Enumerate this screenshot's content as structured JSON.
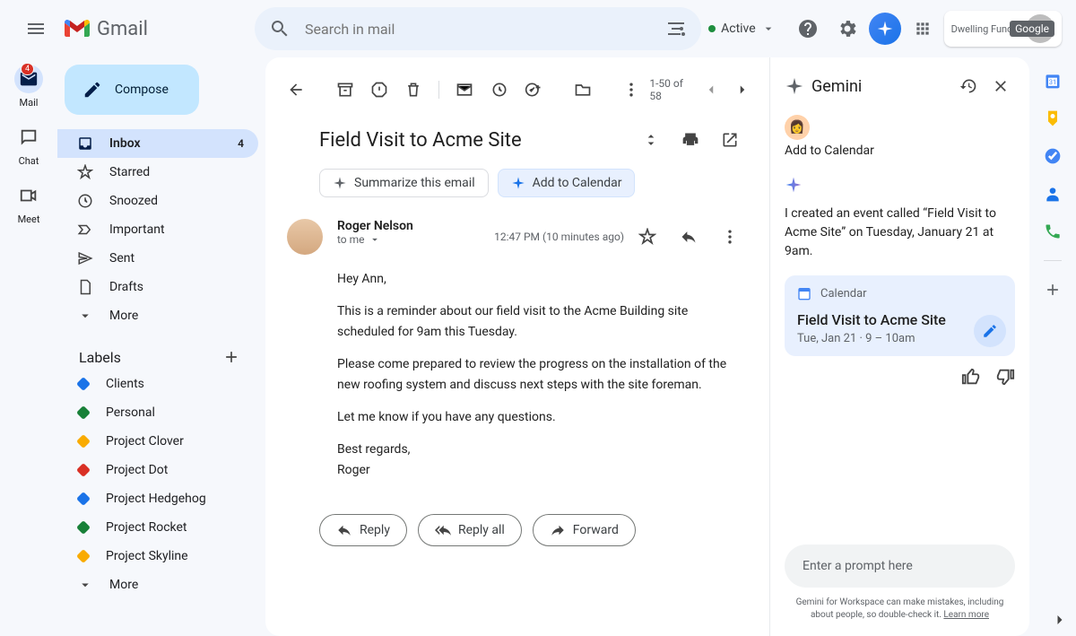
{
  "header": {
    "product": "Gmail",
    "search_placeholder": "Search in mail",
    "status": "Active",
    "profile_org": "Dwelling Fund...",
    "google_badge": "Google"
  },
  "rail": {
    "mail": "Mail",
    "mail_badge": "4",
    "chat": "Chat",
    "meet": "Meet"
  },
  "sidebar": {
    "compose": "Compose",
    "items": [
      {
        "label": "Inbox",
        "count": "4"
      },
      {
        "label": "Starred"
      },
      {
        "label": "Snoozed"
      },
      {
        "label": "Important"
      },
      {
        "label": "Sent"
      },
      {
        "label": "Drafts"
      },
      {
        "label": "More"
      }
    ],
    "labels_header": "Labels",
    "labels": [
      {
        "label": "Clients",
        "color": "#1a73e8"
      },
      {
        "label": "Personal",
        "color": "#188038"
      },
      {
        "label": "Project Clover",
        "color": "#f9ab00"
      },
      {
        "label": "Project Dot",
        "color": "#d93025"
      },
      {
        "label": "Project Hedgehog",
        "color": "#1a73e8"
      },
      {
        "label": "Project Rocket",
        "color": "#188038"
      },
      {
        "label": "Project Skyline",
        "color": "#f9ab00"
      },
      {
        "label": "More"
      }
    ]
  },
  "email": {
    "page_info": "1-50 of 58",
    "subject": "Field Visit to Acme Site",
    "chip_summarize": "Summarize this email",
    "chip_calendar": "Add to Calendar",
    "sender": "Roger Nelson",
    "to": "to me",
    "time": "12:47 PM (10 minutes ago)",
    "body": {
      "greeting": "Hey Ann,",
      "p1": "This is a reminder about our field visit to the Acme Building site scheduled for 9am this Tuesday.",
      "p2": "Please come prepared to review the progress on the installation of the new roofing system and discuss next steps with the site foreman.",
      "p3": "Let me know if you have any questions.",
      "closing": "Best regards,",
      "signature": "Roger"
    },
    "reply": "Reply",
    "reply_all": "Reply all",
    "forward": "Forward"
  },
  "gemini": {
    "title": "Gemini",
    "user_query": "Add to Calendar",
    "response": "I created an event called “Field Visit to Acme Site” on Tuesday, January 21 at 9am.",
    "calendar_label": "Calendar",
    "event_title": "Field Visit to Acme Site",
    "event_time": "Tue, Jan 21 · 9 – 10am",
    "prompt_placeholder": "Enter a prompt here",
    "disclaimer": "Gemini for Workspace can make mistakes, including about people, so double-check it.",
    "learn_more": "Learn more"
  }
}
